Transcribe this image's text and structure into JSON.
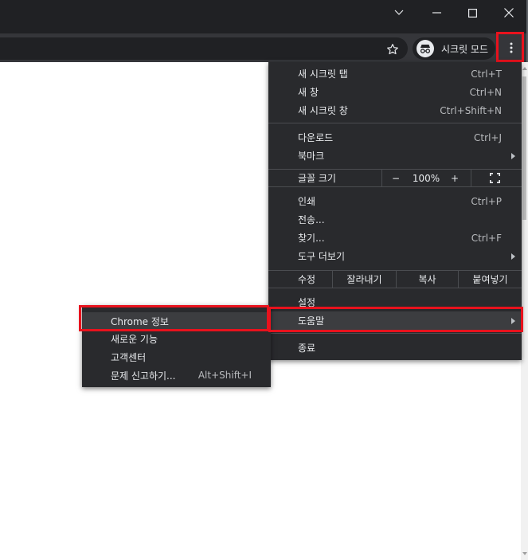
{
  "window": {
    "minimize_icon": "chevron-down-icon",
    "colors": {
      "frame": "#202124",
      "toolbar": "#35363a",
      "menu": "#292a2d",
      "highlight_border": "#e8121d"
    }
  },
  "toolbar": {
    "incognito_label": "시크릿 모드",
    "bookmark_icon": "star-icon",
    "menu_icon": "kebab-menu-icon"
  },
  "menu": {
    "new_incognito_tab": {
      "label": "새 시크릿 탭",
      "shortcut": "Ctrl+T"
    },
    "new_window": {
      "label": "새 창",
      "shortcut": "Ctrl+N"
    },
    "new_incognito_window": {
      "label": "새 시크릿 창",
      "shortcut": "Ctrl+Shift+N"
    },
    "downloads": {
      "label": "다운로드",
      "shortcut": "Ctrl+J"
    },
    "bookmarks": {
      "label": "북마크"
    },
    "zoom": {
      "label": "글꼴 크기",
      "minus": "−",
      "value": "100%",
      "plus": "+"
    },
    "print": {
      "label": "인쇄",
      "shortcut": "Ctrl+P"
    },
    "cast": {
      "label": "전송..."
    },
    "find": {
      "label": "찾기...",
      "shortcut": "Ctrl+F"
    },
    "more_tools": {
      "label": "도구 더보기"
    },
    "edit": {
      "label": "수정",
      "cut": "잘라내기",
      "copy": "복사",
      "paste": "붙여넣기"
    },
    "settings": {
      "label": "설정"
    },
    "help": {
      "label": "도움말"
    },
    "exit": {
      "label": "종료"
    }
  },
  "help_submenu": {
    "about": {
      "label": "Chrome 정보"
    },
    "whats_new": {
      "label": "새로운 기능"
    },
    "help_center": {
      "label": "고객센터"
    },
    "report": {
      "label": "문제 신고하기...",
      "shortcut": "Alt+Shift+I"
    }
  }
}
